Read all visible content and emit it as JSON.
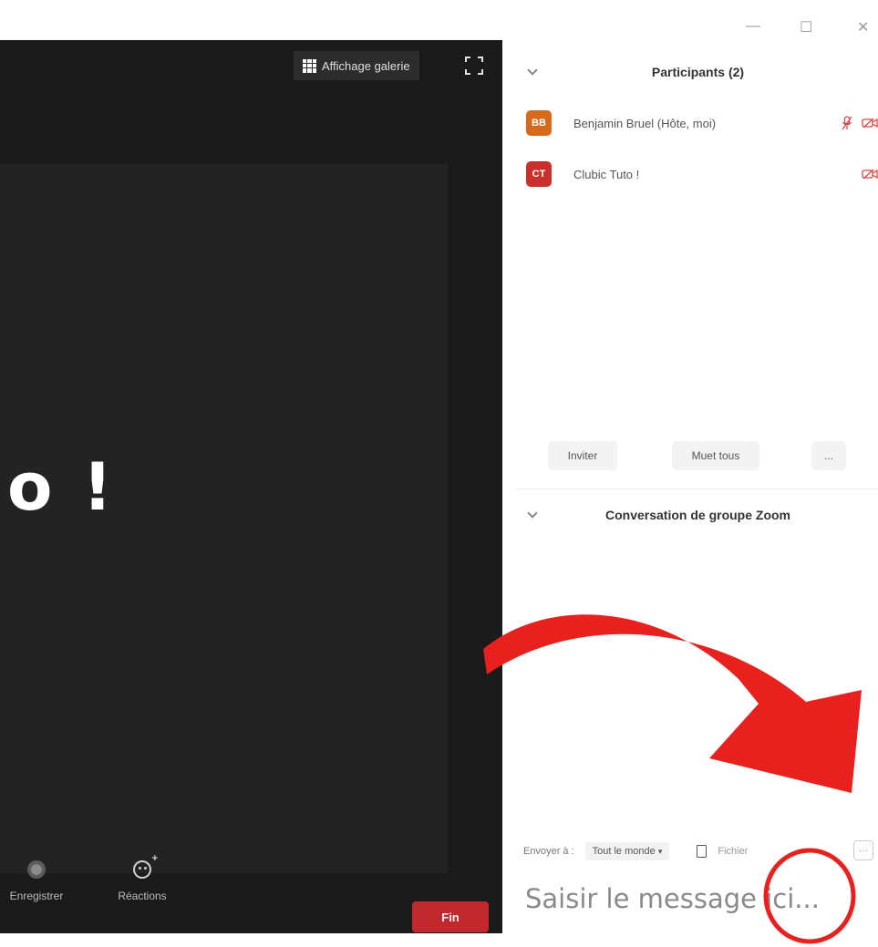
{
  "window": {
    "controls": [
      "—",
      "☐",
      "✕"
    ]
  },
  "meeting": {
    "gallery_label": "Affichage galerie",
    "video_text": "o !",
    "toolbar": {
      "record_label": "Enregistrer",
      "reactions_label": "Réactions",
      "end_label": "Fin"
    }
  },
  "participants": {
    "title": "Participants (2)",
    "items": [
      {
        "initials": "BB",
        "name": "Benjamin Bruel (Hôte, moi)",
        "color": "#d66a1c"
      },
      {
        "initials": "CT",
        "name": "Clubic Tuto !",
        "color": "#c9302c"
      }
    ],
    "invite_label": "Inviter",
    "mute_all_label": "Muet tous",
    "more_label": "..."
  },
  "chat": {
    "title": "Conversation de groupe Zoom",
    "send_to_label": "Envoyer à :",
    "recipient": "Tout le monde",
    "file_label": "Fichier",
    "more_label": "···",
    "placeholder": "Saisir le message ici..."
  },
  "colors": {
    "meeting_bg": "#1a1a1a",
    "tile_bg": "#232323",
    "end_button": "#c0282d",
    "annotation_red": "#e8201e"
  }
}
